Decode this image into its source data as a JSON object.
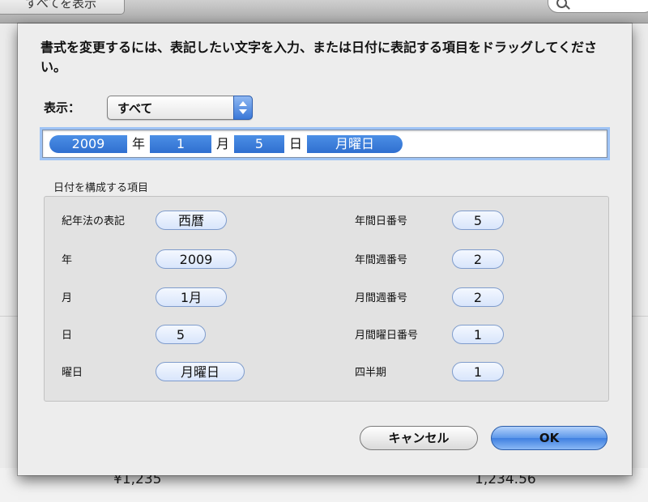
{
  "background": {
    "show_all_button": "すべてを表示",
    "row_values": [
      "¥1,235",
      "1,234.56"
    ]
  },
  "dialog": {
    "instructions": "書式を変更するには、表記したい文字を入力、または日付に表記する項目をドラッグしてください。",
    "show_label": "表示：",
    "show_selected": "すべて",
    "format_tokens": {
      "year": "2009",
      "sep_year": "年",
      "month": "1",
      "sep_month": "月",
      "day": "5",
      "sep_day": "日",
      "weekday": "月曜日"
    },
    "group_title": "日付を構成する項目",
    "elements_left": [
      {
        "label": "紀年法の表記",
        "value": "西暦"
      },
      {
        "label": "年",
        "value": "2009"
      },
      {
        "label": "月",
        "value": "1月"
      },
      {
        "label": "日",
        "value": "5"
      },
      {
        "label": "曜日",
        "value": "月曜日"
      }
    ],
    "elements_right": [
      {
        "label": "年間日番号",
        "value": "5"
      },
      {
        "label": "年間週番号",
        "value": "2"
      },
      {
        "label": "月間週番号",
        "value": "2"
      },
      {
        "label": "月間曜日番号",
        "value": "1"
      },
      {
        "label": "四半期",
        "value": "1"
      }
    ],
    "cancel_button": "キャンセル",
    "ok_button": "OK"
  },
  "colors": {
    "token_blue": "#3a7cdc",
    "focus_ring": "#9ec3f5",
    "pill_border": "#7f9ccc"
  }
}
